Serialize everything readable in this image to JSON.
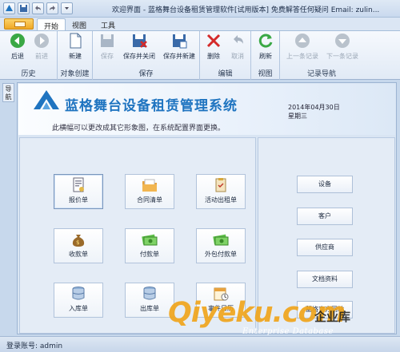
{
  "window": {
    "title": "欢迎界面 - 蓝格舞台设备租赁管理软件[试用版本] 免费解答任何疑问 Email: zulin..."
  },
  "tabs": [
    {
      "label": "开始"
    },
    {
      "label": "视图"
    },
    {
      "label": "工具"
    }
  ],
  "ribbon": {
    "groups": [
      {
        "label": "历史"
      },
      {
        "label": "对象创建"
      },
      {
        "label": "保存"
      },
      {
        "label": "编辑"
      },
      {
        "label": "视图"
      },
      {
        "label": "记录导航"
      }
    ],
    "buttons": {
      "back": "后退",
      "forward": "前进",
      "new": "新建",
      "save": "保存",
      "save_close": "保存并关闭",
      "save_new": "保存并新建",
      "delete": "删除",
      "cancel": "取消",
      "refresh": "刷新",
      "prev": "上一条记录",
      "next": "下一条记录"
    }
  },
  "side_tab": {
    "label": "导航"
  },
  "banner": {
    "title": "蓝格舞台设备租赁管理系统",
    "subtitle": "此横幅可以更改成其它形象图，在系统配置界面更换。",
    "date": "2014年04月30日",
    "weekday": "星期三"
  },
  "tiles": [
    {
      "label": "报价单",
      "icon": "quote-doc-icon"
    },
    {
      "label": "合同清单",
      "icon": "folder-icon"
    },
    {
      "label": "活动出租单",
      "icon": "clipboard-icon"
    },
    {
      "label": "收款单",
      "icon": "money-bag-icon"
    },
    {
      "label": "付款单",
      "icon": "cash-icon"
    },
    {
      "label": "外包付款单",
      "icon": "cash-icon"
    },
    {
      "label": "入库单",
      "icon": "database-icon"
    },
    {
      "label": "出库单",
      "icon": "database-icon"
    },
    {
      "label": "事件日历",
      "icon": "calendar-icon"
    }
  ],
  "side_buttons": [
    "设备",
    "客户",
    "供应商",
    "文档资料",
    "蓝格官方网站"
  ],
  "status": {
    "login": "登录账号: admin"
  },
  "watermark": {
    "logo": "Qiyeku.com",
    "cn": "企业库",
    "en": "Enterprise Database"
  },
  "colors": {
    "accent": "#1f74c0",
    "ribbon_bg": "#e1eaf6",
    "watermark": "#f0a51c"
  }
}
